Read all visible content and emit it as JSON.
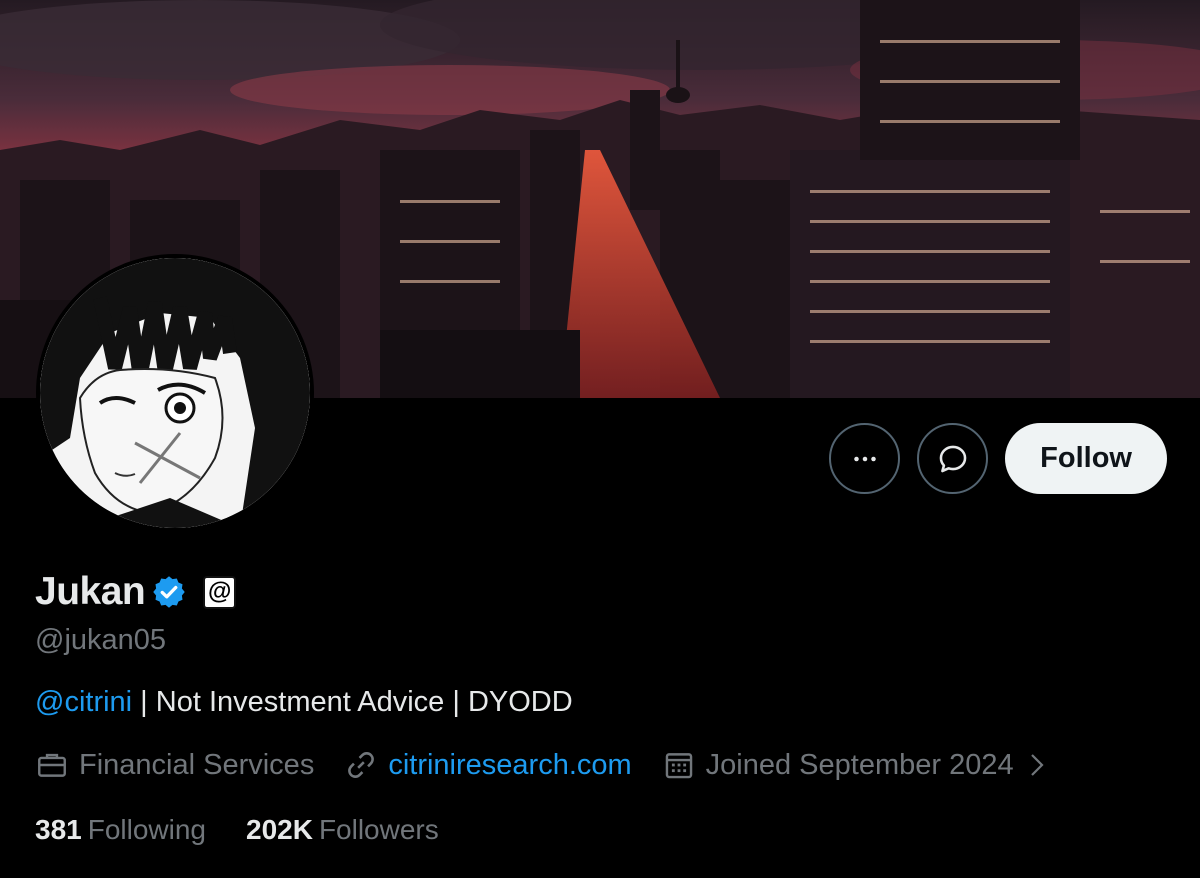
{
  "profile": {
    "name": "Jukan",
    "handle": "@jukan05",
    "affiliation_badge": "@",
    "bio": {
      "mention": "@citrini",
      "text": " | Not Investment Advice | DYODD"
    },
    "category": "Financial Services",
    "website": "citriniresearch.com",
    "joined": "Joined September 2024"
  },
  "stats": {
    "following_count": "381",
    "following_label": "Following",
    "followers_count": "202K",
    "followers_label": "Followers"
  },
  "actions": {
    "more_icon": "more-icon",
    "message_icon": "message-icon",
    "follow_label": "Follow"
  },
  "colors": {
    "accent": "#1d9bf0",
    "muted": "#71767b",
    "text": "#e7e9ea",
    "background": "#000000"
  }
}
